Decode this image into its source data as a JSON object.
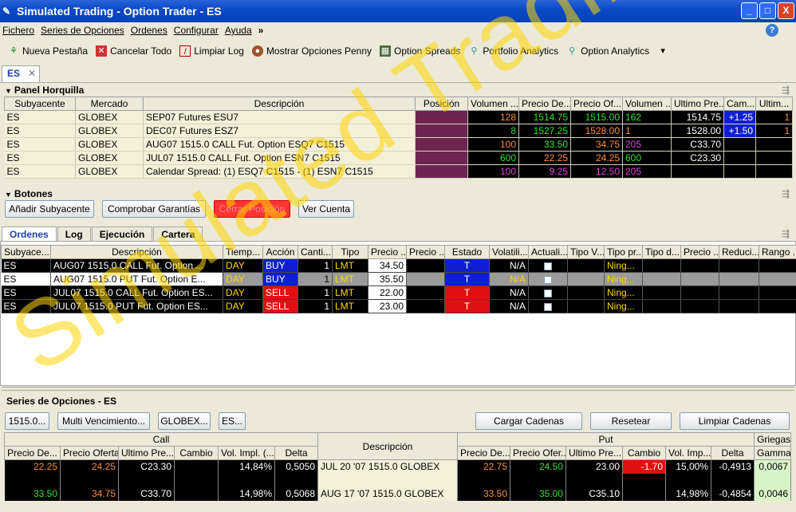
{
  "window": {
    "title": "Simulated Trading - Option Trader - ES",
    "min": "_",
    "max": "□",
    "close": "X"
  },
  "menu": [
    "Fichero",
    "Series de Opciones",
    "Ordenes",
    "Configurar",
    "Ayuda"
  ],
  "menu_more": "»",
  "toolbar": [
    {
      "icon": "new-tab-icon",
      "label": "Nueva Pestaña"
    },
    {
      "icon": "cancel-all-icon",
      "label": "Cancelar Todo"
    },
    {
      "icon": "clear-log-icon",
      "label": "Limpiar Log"
    },
    {
      "icon": "penny-options-icon",
      "label": "Mostrar Opciones Penny"
    },
    {
      "icon": "option-spreads-icon",
      "label": "Option Spreads"
    },
    {
      "icon": "portfolio-analytics-icon",
      "label": "Portfolio Analytics"
    },
    {
      "icon": "option-analytics-icon",
      "label": "Option Analytics"
    }
  ],
  "page_tab": "ES",
  "panel_horquilla": {
    "title": "Panel Horquilla",
    "headers": [
      "Subyacente",
      "Mercado",
      "Descripción",
      "Posición",
      "Volumen ...",
      "Precio De...",
      "Precio Of...",
      "Volumen ...",
      "Ultimo Pre...",
      "Cam...",
      "Ultim..."
    ],
    "rows": [
      [
        "ES",
        "GLOBEX",
        "SEP07 Futures ESU7",
        "",
        "128",
        "1514.75",
        "1515.00",
        "162",
        "1514.75",
        "+1.25",
        "1"
      ],
      [
        "ES",
        "GLOBEX",
        "DEC07 Futures ESZ7",
        "",
        "8",
        "1527.25",
        "1528.00",
        "1",
        "1528.00",
        "+1.50",
        "1"
      ],
      [
        "ES",
        "GLOBEX",
        "AUG07 1515.0 CALL Fut. Option ESQ7 C1515",
        "",
        "100",
        "33.50",
        "34.75",
        "205",
        "C33.70",
        "",
        ""
      ],
      [
        "ES",
        "GLOBEX",
        "JUL07 1515.0 CALL Fut. Option ESN7 C1515",
        "",
        "600",
        "22.25",
        "24.25",
        "600",
        "C23.30",
        "",
        ""
      ],
      [
        "ES",
        "GLOBEX",
        "Calendar Spread: (1) ESQ7 C1515 - (1) ESN7 C1515",
        "",
        "100",
        "9.25",
        "12.50",
        "205",
        "",
        "",
        ""
      ]
    ]
  },
  "botones": {
    "title": "Botones",
    "buttons": [
      "Añadir Subyacente",
      "Comprobar Garantías",
      "Cerrar Posición",
      "Ver Cuenta"
    ]
  },
  "order_tabs": [
    "Ordenes",
    "Log",
    "Ejecución",
    "Cartera"
  ],
  "orders": {
    "headers": [
      "Subyace...",
      "Descripción",
      "Tiemp...",
      "Acción",
      "Canti...",
      "Tipo",
      "Precio ...",
      "Precio ...",
      "Estado",
      "Volatili...",
      "Actuali...",
      "Tipo V...",
      "Tipo pr...",
      "Tipo d...",
      "Precio ...",
      "Reduci...",
      "Rango ..."
    ],
    "rows": [
      [
        "ES",
        "AUG07 1515.0 CALL Fut. Option ...",
        "DAY",
        "BUY",
        "1",
        "LMT",
        "34.50",
        "",
        "T",
        "N/A",
        "",
        "",
        "Ning..."
      ],
      [
        "ES",
        "AUG07 1515.0 PUT Fut. Option E...",
        "DAY",
        "BUY",
        "1",
        "LMT",
        "35.50",
        "",
        "T",
        "N/A",
        "",
        "",
        "Ning..."
      ],
      [
        "ES",
        "JUL07 1515.0 CALL Fut. Option ES...",
        "DAY",
        "SELL",
        "1",
        "LMT",
        "22.00",
        "",
        "T",
        "N/A",
        "",
        "",
        "Ning..."
      ],
      [
        "ES",
        "JUL07 1515.0 PUT Fut. Option ES...",
        "DAY",
        "SELL",
        "1",
        "LMT",
        "23.00",
        "",
        "T",
        "N/A",
        "",
        "",
        "Ning..."
      ]
    ]
  },
  "series": {
    "title": "Series de Opciones - ES",
    "filters": [
      "1515.0...",
      "Multi Vencimiento...",
      "GLOBEX...",
      "ES..."
    ],
    "actions": [
      "Cargar Cadenas",
      "Resetear",
      "Limpiar Cadenas"
    ],
    "call_label": "Call",
    "put_label": "Put",
    "greeks_label": "Griegas",
    "desc_label": "Descripción",
    "call_headers": [
      "Precio De...",
      "Precio Oferta",
      "Ultimo Pre...",
      "Cambio",
      "Vol. Impl. (...",
      "Delta"
    ],
    "put_headers": [
      "Precio De...",
      "Precio Ofer...",
      "Ultimo Pre...",
      "Cambio",
      "Vol. Imp...",
      "Delta"
    ],
    "greek_headers": [
      "Gamma"
    ],
    "rows": [
      {
        "call": [
          "22.25",
          "24.25",
          "C23.30",
          "",
          "14,84%",
          "0,5050"
        ],
        "desc": "JUL 20 '07 1515.0 GLOBEX",
        "put": [
          "22.75",
          "24.50",
          "23.00",
          "-1.70",
          "15,00%",
          "-0,4913"
        ],
        "gamma": "0,0067"
      },
      {
        "call": [
          "33.50",
          "34.75",
          "C33.70",
          "",
          "14,98%",
          "0,5068"
        ],
        "desc": "AUG 17 '07 1515.0 GLOBEX",
        "put": [
          "33.50",
          "35.00",
          "C35.10",
          "",
          "14,98%",
          "-0,4854"
        ],
        "gamma": "0,0046"
      }
    ]
  },
  "watermark": "Simulated Trading"
}
